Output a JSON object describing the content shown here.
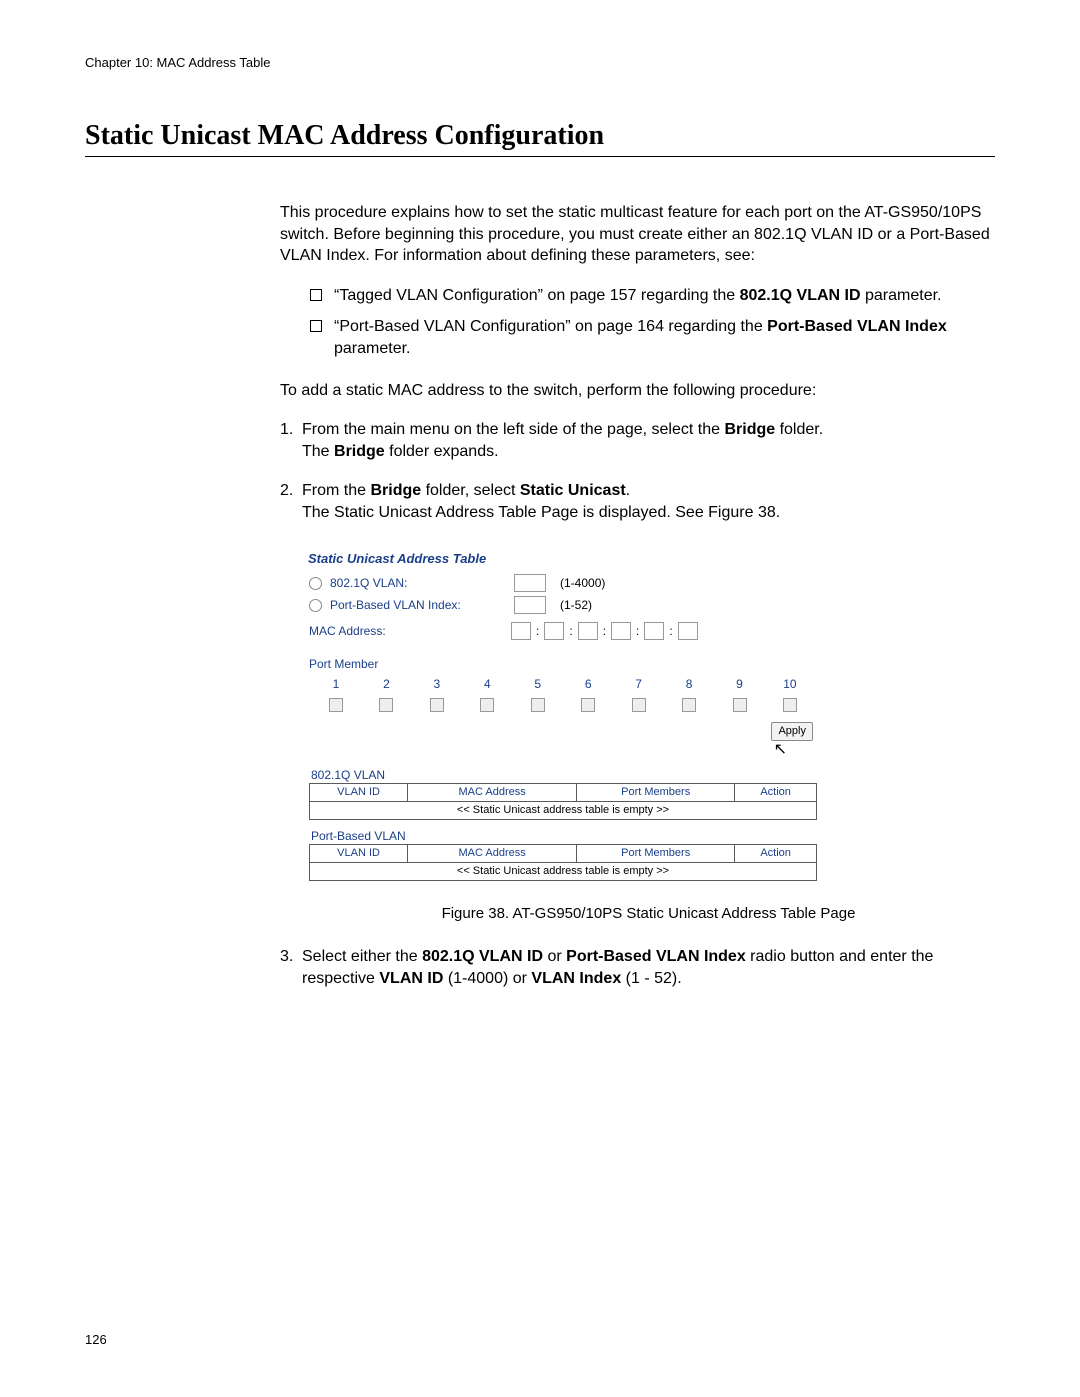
{
  "chapter": "Chapter 10: MAC Address Table",
  "heading": "Static Unicast MAC Address Configuration",
  "intro": "This procedure explains how to set the static multicast feature for each port on the AT-GS950/10PS switch. Before beginning this procedure, you must create either an 802.1Q VLAN ID or a Port-Based VLAN Index. For information about defining these parameters, see:",
  "bullet1_pre": "“Tagged VLAN Configuration” on page 157 regarding the ",
  "bullet1_bold": "802.1Q VLAN ID",
  "bullet1_post": " parameter.",
  "bullet2_pre": "“Port-Based VLAN Configuration” on page 164 regarding the ",
  "bullet2_bold": "Port-Based VLAN Index",
  "bullet2_post": " parameter.",
  "transition": "To add a static MAC address to the switch, perform the following procedure:",
  "step1_num": "1.",
  "step1_a": "From the main menu on the left side of the page, select the ",
  "step1_bold1": "Bridge",
  "step1_b": " folder.",
  "step1_c": "The ",
  "step1_bold2": "Bridge",
  "step1_d": " folder expands.",
  "step2_num": "2.",
  "step2_a": "From the ",
  "step2_bold1": "Bridge",
  "step2_b": " folder, select ",
  "step2_bold2": "Static Unicast",
  "step2_c": ".",
  "step2_d": "The Static Unicast Address Table Page is displayed. See Figure 38.",
  "fig": {
    "title": "Static Unicast Address Table",
    "radio1": "802.1Q VLAN:",
    "radio1_range": "(1-4000)",
    "radio2": "Port-Based VLAN Index:",
    "radio2_range": "(1-52)",
    "mac_label": "MAC Address:",
    "port_member_label": "Port Member",
    "ports": [
      "1",
      "2",
      "3",
      "4",
      "5",
      "6",
      "7",
      "8",
      "9",
      "10"
    ],
    "apply": "Apply",
    "sec1": "802.1Q VLAN",
    "sec2": "Port-Based VLAN",
    "th_vlanid": "VLAN ID",
    "th_mac": "MAC Address",
    "th_pm": "Port Members",
    "th_act": "Action",
    "empty_msg": "<< Static Unicast address table is empty >>"
  },
  "caption": "Figure 38. AT-GS950/10PS Static Unicast Address Table Page",
  "step3_num": "3.",
  "step3_a": "Select either the ",
  "step3_bold1": "802.1Q VLAN ID",
  "step3_b": " or ",
  "step3_bold2": "Port-Based VLAN Index",
  "step3_c": " radio button and enter the respective ",
  "step3_bold3": "VLAN ID",
  "step3_d": " (1-4000) or ",
  "step3_bold4": "VLAN Index",
  "step3_e": " (1 - 52).",
  "page_number": "126"
}
